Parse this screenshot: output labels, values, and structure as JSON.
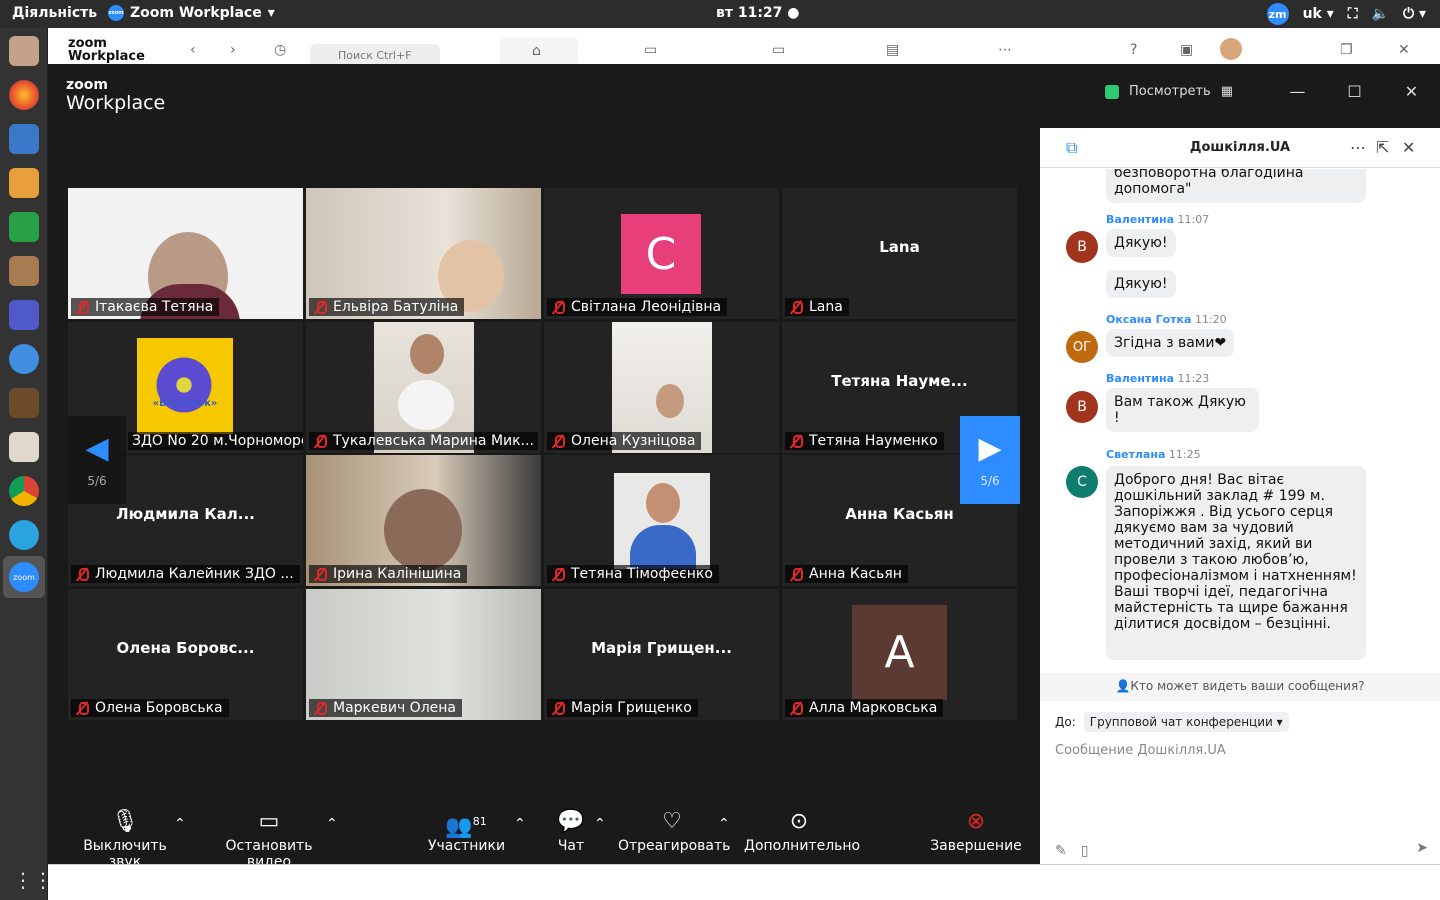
{
  "system": {
    "activities": "Діяльність",
    "app_name": "Zoom Workplace",
    "clock": "вт 11:27",
    "avatar_initials": "zm",
    "lang": "uk"
  },
  "host_window": {
    "logo_line1": "zoom",
    "logo_line2": "Workplace",
    "search_placeholder": "Поиск Ctrl+F"
  },
  "meeting": {
    "logo_line1": "zoom",
    "logo_line2": "Workplace",
    "view_label": "Посмотреть"
  },
  "tiles": [
    {
      "name": "Ітакаєва Тетяна"
    },
    {
      "name": "Ельвіра Батуліна"
    },
    {
      "name": "Світлана Леонідівна",
      "avatar_letter": "С",
      "avatar_color": "#e83e7a"
    },
    {
      "name": "Lana",
      "display": "Lana"
    },
    {
      "name": "ЗДО No 20 м.Чорноморська",
      "badge_text": "«Барвінок»"
    },
    {
      "name": "Тукалевська Марина Мик..."
    },
    {
      "name": "Олена Кузніцова"
    },
    {
      "name": "Тетяна Науменко",
      "display": "Тетяна Науме..."
    },
    {
      "name": "Людмила Калейник ЗДО ...",
      "display": "Людмила Кал..."
    },
    {
      "name": "Ірина Калінішина"
    },
    {
      "name": "Тетяна Тімофеєнко"
    },
    {
      "name": "Анна Касьян",
      "display": "Анна Касьян"
    },
    {
      "name": "Олена Боровська",
      "display": "Олена Боровс..."
    },
    {
      "name": "Маркевич Олена"
    },
    {
      "name": "Марія Грищенко",
      "display": "Марія Грищен..."
    },
    {
      "name": "Алла Марковська",
      "avatar_letter": "А",
      "avatar_color": "#5a3a32"
    }
  ],
  "pager": {
    "left": "5/6",
    "right": "5/6"
  },
  "toolbar": {
    "mute": "Выключить звук",
    "video": "Остановить видео",
    "participants": "Участники",
    "participants_count": "81",
    "chat": "Чат",
    "react": "Отреагировать",
    "more": "Дополнительно",
    "end": "Завершение"
  },
  "chat": {
    "title": "Дошкілля.UA",
    "partial_message": "безповоротна благодійна допомога\"",
    "messages": [
      {
        "sender": "Валентина",
        "time": "11:07",
        "initials": "В",
        "color": "#a0341c",
        "texts": [
          "Дякую!",
          "Дякую!"
        ]
      },
      {
        "sender": "Оксана Готка",
        "time": "11:20",
        "initials": "ОГ",
        "color": "#c06a10",
        "texts": [
          "Згідна з вами❤"
        ]
      },
      {
        "sender": "Валентина",
        "time": "11:23",
        "initials": "В",
        "color": "#a0341c",
        "texts": [
          "Вам також  Дякую !"
        ]
      },
      {
        "sender": "Светлана",
        "time": "11:25",
        "initials": "С",
        "color": "#0e7d6e",
        "texts": [
          "Доброго дня! Вас вітає дошкільний заклад # 199 м. Запоріжжя .              Від усього серця дякуємо вам за чудовий методичний захід, який ви провели з такою любов’ю, професіоналізмом і натхненням! Ваші творчі ідеї, педагогічна майстерність та щире бажання ділитися досвідом – безцінні."
        ]
      }
    ],
    "who_can_see": "Кто может видеть ваши сообщения?",
    "to_label": "До:",
    "to_value": "Групповой чат конференции",
    "compose_placeholder": "Сообщение Дошкілля.UA"
  },
  "colors": {
    "accent": "#2d8cff",
    "panel": "#1a1a1a",
    "tile": "#232323",
    "mute_red": "#e02828",
    "end_red": "#e02828"
  }
}
